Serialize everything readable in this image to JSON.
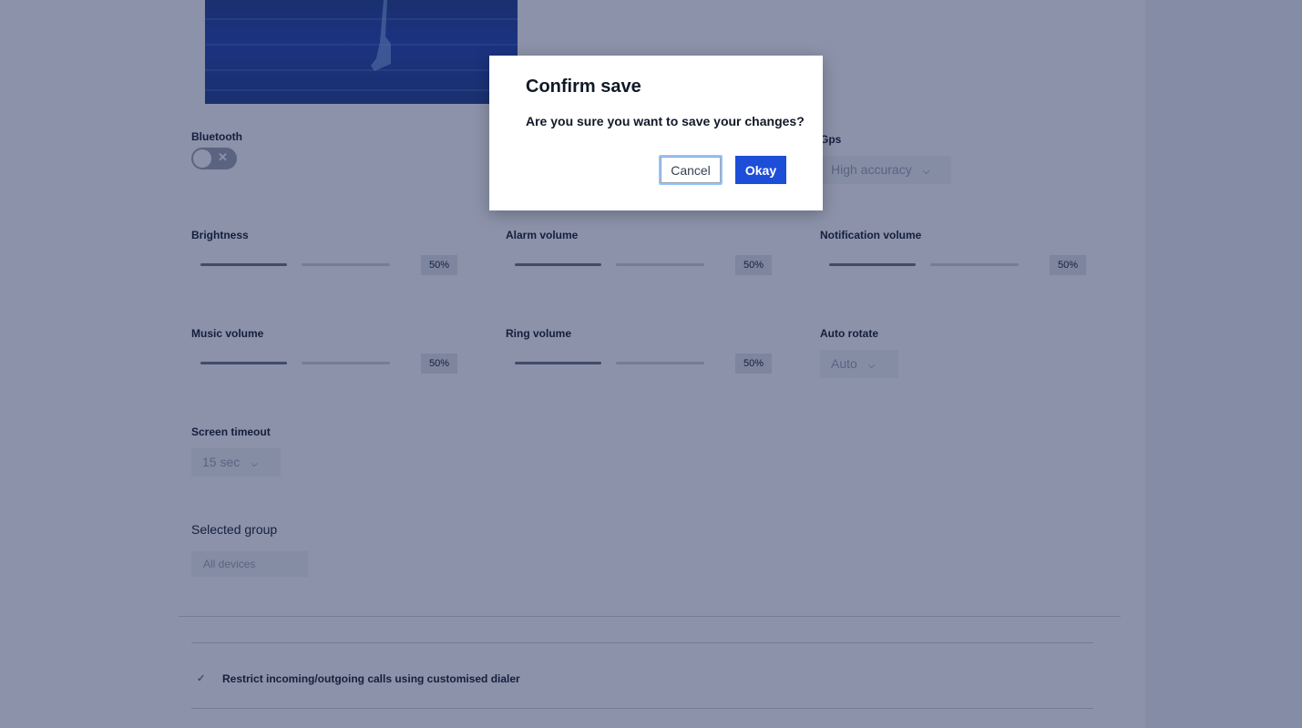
{
  "settings": {
    "bluetooth": {
      "label": "Bluetooth",
      "enabled": false
    },
    "gps": {
      "label": "Gps",
      "value": "High accuracy"
    },
    "brightness": {
      "label": "Brightness",
      "value": "50%",
      "level": 0.5
    },
    "alarm_volume": {
      "label": "Alarm volume",
      "value": "50%",
      "level": 0.5
    },
    "notification_volume": {
      "label": "Notification volume",
      "value": "50%",
      "level": 0.5
    },
    "music_volume": {
      "label": "Music volume",
      "value": "50%",
      "level": 0.5
    },
    "ring_volume": {
      "label": "Ring volume",
      "value": "50%",
      "level": 0.5
    },
    "auto_rotate": {
      "label": "Auto rotate",
      "value": "Auto"
    },
    "screen_timeout": {
      "label": "Screen timeout",
      "value": "15 sec"
    }
  },
  "selected_group": {
    "label": "Selected group",
    "value": "All devices"
  },
  "restrict_calls": {
    "label": "Restrict incoming/outgoing calls using customised dialer",
    "checked": true
  },
  "modal": {
    "title": "Confirm save",
    "message": "Are you sure you want to save your changes?",
    "cancel_label": "Cancel",
    "okay_label": "Okay"
  },
  "icons": {
    "toggle_off": "close-icon",
    "dropdown": "chevron-down-icon",
    "check": "check-icon"
  },
  "colors": {
    "primary": "#1d4ed8",
    "overlay": "#172554"
  }
}
